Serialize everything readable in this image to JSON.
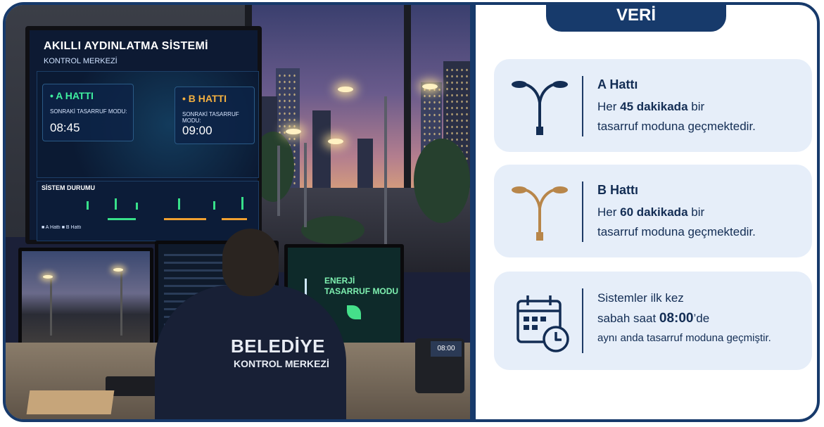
{
  "photo": {
    "wall_screen": {
      "title": "AKILLI AYDINLATMA SİSTEMİ",
      "subtitle": "KONTROL MERKEZİ",
      "card_a": {
        "title": "• A HATTI",
        "label": "SONRAKİ TASARRUF MODU:",
        "value": "08:45"
      },
      "card_b": {
        "title": "• B HATTI",
        "label": "SONRAKİ TASARRUF MODU:",
        "value": "09:00"
      },
      "status_label": "SİSTEM DURUMU",
      "legend": "■ A Hattı   ■ B Hattı"
    },
    "energy_monitor": {
      "line1": "ENERJİ",
      "line2": "TASARRUF MODU"
    },
    "badge": {
      "line1": "BELEDİYE",
      "line2": "KONTROL MERKEZİ"
    },
    "phone_time": "08:00"
  },
  "panel": {
    "header": "VERİ",
    "item_a": {
      "title": "A Hattı",
      "line1_prefix": "Her ",
      "line1_bold": "45 dakikada",
      "line1_suffix": " bir",
      "line2": "tasarruf moduna geçmektedir.",
      "icon": "street-lamp-icon",
      "icon_color": "#132d54"
    },
    "item_b": {
      "title": "B Hattı",
      "line1_prefix": "Her ",
      "line1_bold": "60 dakikada",
      "line1_suffix": " bir",
      "line2": "tasarruf moduna geçmektedir.",
      "icon": "street-lamp-icon",
      "icon_color": "#b8864a"
    },
    "item_c": {
      "line1": "Sistemler ilk kez",
      "line2_prefix": "sabah saat ",
      "line2_bold": "08:00",
      "line2_suffix": "’de",
      "line3": "aynı anda tasarruf moduna geçmiştir.",
      "icon": "calendar-clock-icon"
    }
  },
  "colors": {
    "navy": "#173a6b",
    "card_bg": "#e6eef9",
    "green": "#38e08a",
    "orange": "#f0a030"
  }
}
